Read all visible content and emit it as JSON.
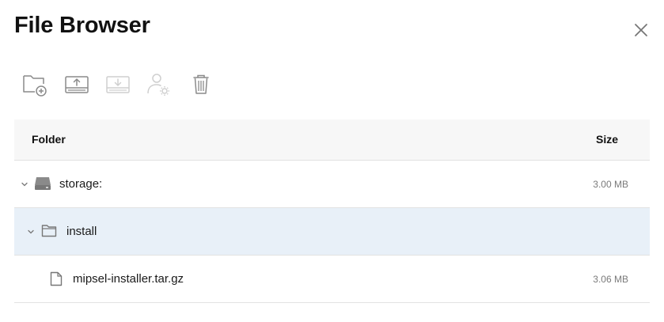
{
  "dialog": {
    "title": "File Browser",
    "close_icon": "close-icon"
  },
  "toolbar": {
    "buttons": [
      {
        "icon": "new-folder-icon",
        "enabled": true
      },
      {
        "icon": "upload-icon",
        "enabled": true
      },
      {
        "icon": "download-icon",
        "enabled": false
      },
      {
        "icon": "user-settings-icon",
        "enabled": false
      },
      {
        "icon": "trash-icon",
        "enabled": true
      }
    ]
  },
  "table": {
    "headers": {
      "folder": "Folder",
      "size": "Size"
    },
    "rows": [
      {
        "icon": "drive-icon",
        "label": "storage:",
        "size": "3.00 MB",
        "expanded": true,
        "selected": false
      },
      {
        "icon": "folder-icon",
        "label": "install",
        "size": "",
        "expanded": true,
        "selected": true
      },
      {
        "icon": "file-icon",
        "label": "mipsel-installer.tar.gz",
        "size": "3.06 MB",
        "expanded": false,
        "selected": false
      }
    ]
  },
  "colors": {
    "selected_row": "#e8f0f8",
    "header_bg": "#f7f7f7",
    "icon_enabled": "#8a8a8a",
    "icon_disabled": "#cfcfcf"
  }
}
